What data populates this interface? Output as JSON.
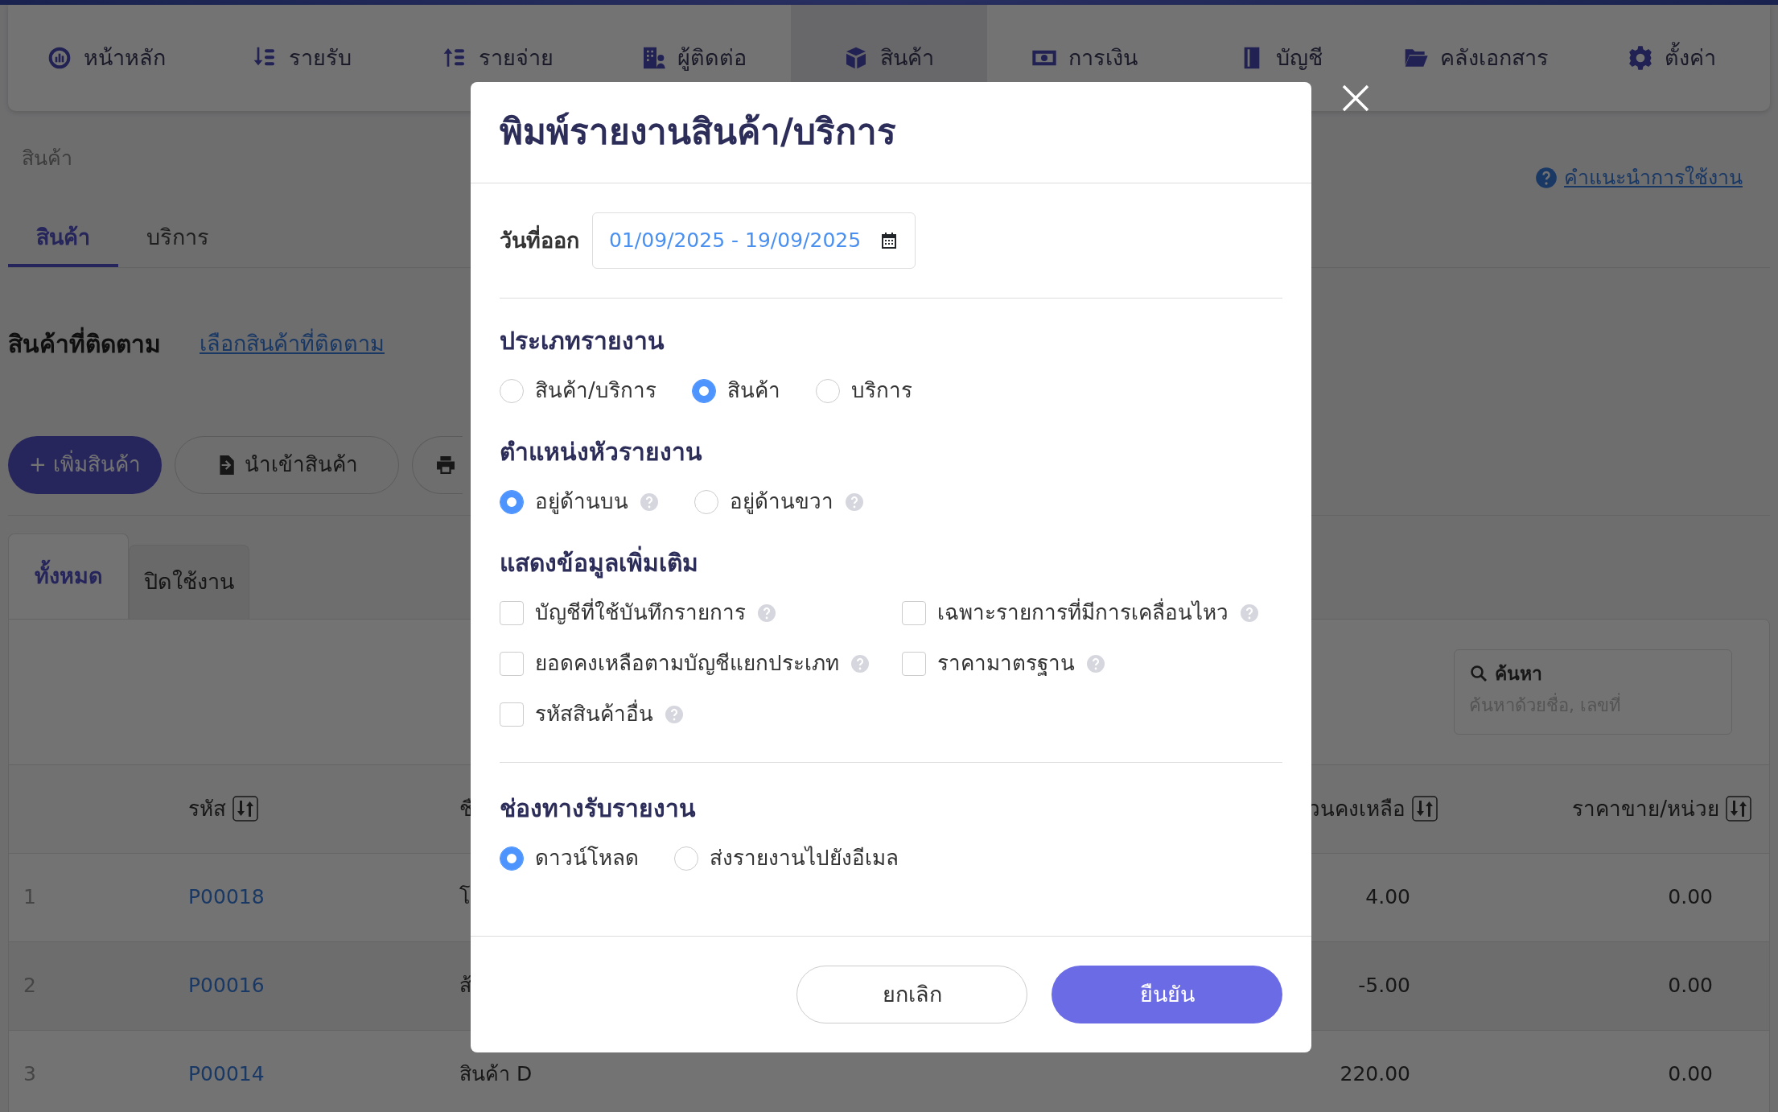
{
  "top_nav": {
    "items": [
      {
        "label": "หน้าหลัก",
        "kind": "home",
        "selected": false
      },
      {
        "label": "รายรับ",
        "kind": "income",
        "selected": false
      },
      {
        "label": "รายจ่าย",
        "kind": "expense",
        "selected": false
      },
      {
        "label": "ผู้ติดต่อ",
        "kind": "contacts",
        "selected": false
      },
      {
        "label": "สินค้า",
        "kind": "products",
        "selected": true
      },
      {
        "label": "การเงิน",
        "kind": "finance",
        "selected": false
      },
      {
        "label": "บัญชี",
        "kind": "accounts",
        "selected": false
      },
      {
        "label": "คลังเอกสาร",
        "kind": "documents",
        "selected": false
      },
      {
        "label": "ตั้งค่า",
        "kind": "settings",
        "selected": false
      }
    ]
  },
  "breadcrumb": "สินค้า",
  "help_link": "คำแนะนำการใช้งาน",
  "page_tabs": [
    {
      "label": "สินค้า",
      "selected": true
    },
    {
      "label": "บริการ",
      "selected": false
    }
  ],
  "tracked_products": {
    "title": "สินค้าที่ติดตาม",
    "link": "เลือกสินค้าที่ติดตาม"
  },
  "toolbar": [
    {
      "kind": "add",
      "label": "+ เพิ่มสินค้า"
    },
    {
      "kind": "import",
      "label": "นำเข้าสินค้า"
    },
    {
      "kind": "print"
    }
  ],
  "list_tabs": [
    {
      "label": "ทั้งหมด",
      "selected": true
    },
    {
      "label": "ปิดใช้งาน",
      "selected": false
    }
  ],
  "search": {
    "label": "ค้นหา",
    "placeholder": "ค้นหาด้วยชื่อ, เลขที่"
  },
  "table": {
    "columns": [
      {
        "label": "รหัส",
        "sortable": true
      },
      {
        "label": "ชื",
        "sortable": false
      },
      {
        "label": "วนคงเหลือ",
        "sortable": true
      },
      {
        "label": "ราคาขาย/หน่วย",
        "sortable": true
      }
    ],
    "rows": [
      {
        "number": "1",
        "code": "P00018",
        "name": "โ",
        "remaining": "4.00",
        "price": "0.00"
      },
      {
        "number": "2",
        "code": "P00016",
        "name": "ส้",
        "remaining": "-5.00",
        "price": "0.00"
      },
      {
        "number": "3",
        "code": "P00014",
        "name": "สินค้า D",
        "remaining": "220.00",
        "price": "0.00"
      }
    ]
  },
  "dialog": {
    "title": "พิมพ์รายงานสินค้า/บริการ",
    "date": {
      "label": "วันที่ออก",
      "value": "01/09/2025 - 19/09/2025"
    },
    "sections": [
      {
        "title": "ประเภทรายงาน",
        "kind": "radio",
        "options": [
          {
            "label": "สินค้า/บริการ",
            "selected": false
          },
          {
            "label": "สินค้า",
            "selected": true
          },
          {
            "label": "บริการ",
            "selected": false
          }
        ]
      },
      {
        "title": "ตำแหน่งหัวรายงาน",
        "kind": "radio",
        "options": [
          {
            "label": "อยู่ด้านบน",
            "selected": true,
            "help": true
          },
          {
            "label": "อยู่ด้านขวา",
            "selected": false,
            "help": true
          }
        ]
      },
      {
        "title": "แสดงข้อมูลเพิ่มเติม",
        "kind": "checkbox",
        "options": [
          {
            "label": "บัญชีที่ใช้บันทึกรายการ",
            "checked": false,
            "help": true
          },
          {
            "label": "เฉพาะรายการที่มีการเคลื่อนไหว",
            "checked": false,
            "help": true
          },
          {
            "label": "ยอดคงเหลือตามบัญชีแยกประเภท",
            "checked": false,
            "help": true
          },
          {
            "label": "ราคามาตรฐาน",
            "checked": false,
            "help": true
          },
          {
            "label": "รหัสสินค้าอื่น",
            "checked": false,
            "help": true
          }
        ]
      },
      {
        "title": "ช่องทางรับรายงาน",
        "kind": "radio",
        "divider_before": true,
        "options": [
          {
            "label": "ดาวน์โหลด",
            "selected": true
          },
          {
            "label": "ส่งรายงานไปยังอีเมล",
            "selected": false
          }
        ]
      }
    ],
    "buttons": [
      {
        "label": "ยกเลิก",
        "kind": "secondary"
      },
      {
        "label": "ยืนยัน",
        "kind": "primary"
      }
    ]
  }
}
